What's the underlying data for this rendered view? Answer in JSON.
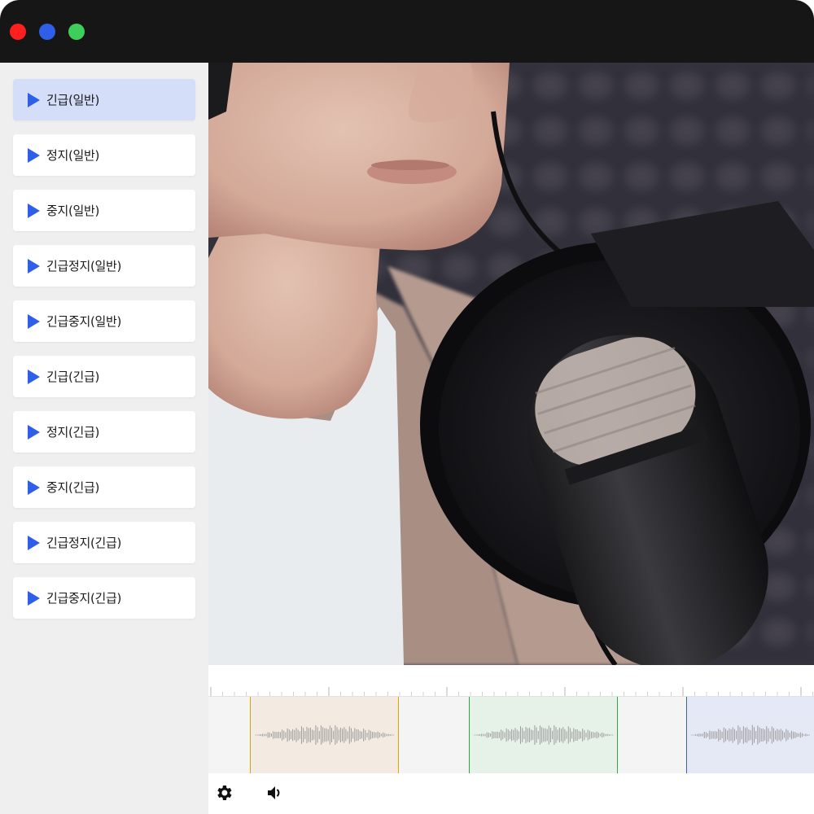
{
  "window": {
    "controls": [
      {
        "name": "close",
        "color": "#ff1f1f"
      },
      {
        "name": "minimize",
        "color": "#2f5fe8"
      },
      {
        "name": "maximize",
        "color": "#3ecf5a"
      }
    ]
  },
  "sidebar": {
    "items": [
      {
        "label": "긴급(일반)",
        "active": true
      },
      {
        "label": "정지(일반)",
        "active": false
      },
      {
        "label": "중지(일반)",
        "active": false
      },
      {
        "label": "긴급정지(일반)",
        "active": false
      },
      {
        "label": "긴급중지(일반)",
        "active": false
      },
      {
        "label": "긴급(긴급)",
        "active": false
      },
      {
        "label": "정지(긴급)",
        "active": false
      },
      {
        "label": "중지(긴급)",
        "active": false
      },
      {
        "label": "긴급정지(긴급)",
        "active": false
      },
      {
        "label": "긴급중지(긴급)",
        "active": false
      }
    ],
    "item_icon": "play-icon"
  },
  "player": {
    "image": "woman-speaking-into-microphone",
    "timeline": {
      "clips": [
        {
          "name": "clip-1",
          "color": "#e3a000"
        },
        {
          "name": "clip-2",
          "color": "#2aa845"
        },
        {
          "name": "clip-3",
          "color": "#2f5fe8"
        }
      ]
    },
    "controls": {
      "settings_icon": "gear-icon",
      "volume_icon": "speaker-icon"
    }
  },
  "colors": {
    "accent": "#2f5fe8",
    "active_item_bg": "#d4def9",
    "titlebar": "#161616"
  }
}
